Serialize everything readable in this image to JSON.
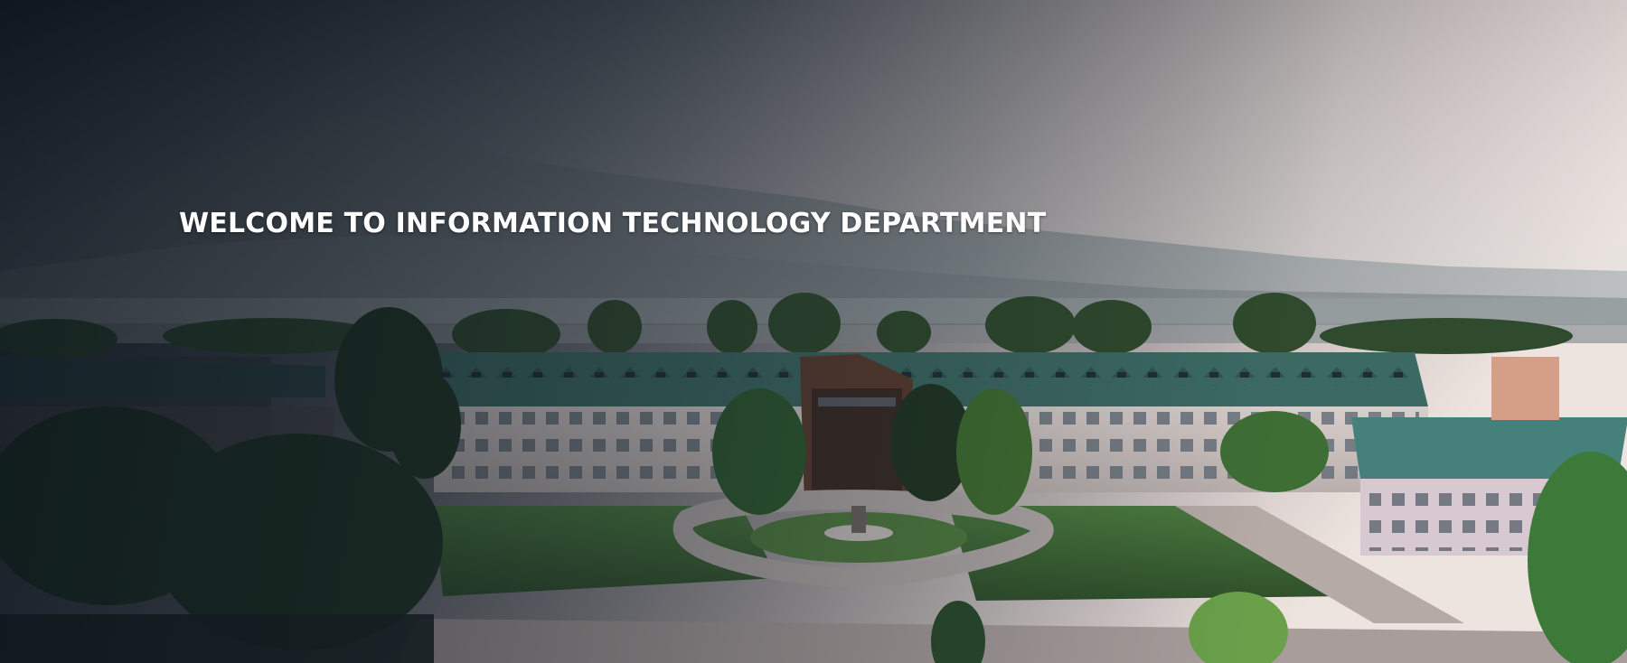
{
  "hero": {
    "title": "WELCOME TO INFORMATION TECHNOLOGY DEPARTMENT",
    "image": "campus-panorama",
    "colors": {
      "sky_top_left": "#1d2530",
      "sky_right": "#e7dcd8",
      "roof_green": "#3f6d66",
      "building_wall": "#d9d0cd",
      "lawn": "#4f7c3e",
      "title_text": "#ffffff"
    }
  }
}
